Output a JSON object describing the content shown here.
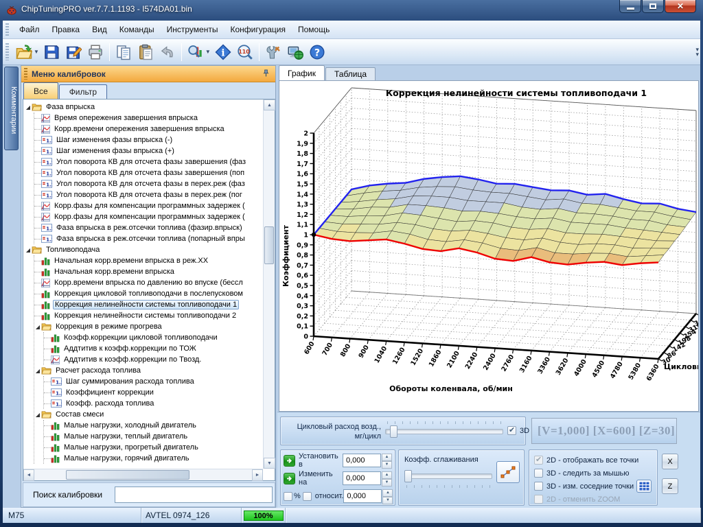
{
  "window": {
    "title": "ChipTuningPRO ver.7.7.1.1193 - I574DA01.bin"
  },
  "menu_bar": {
    "items": [
      "Файл",
      "Правка",
      "Вид",
      "Команды",
      "Инструменты",
      "Конфигурация",
      "Помощь"
    ]
  },
  "toolbar": {
    "buttons": [
      {
        "icon": "open-file-icon",
        "dropdown": true
      },
      {
        "icon": "save-icon"
      },
      {
        "icon": "save-edit-icon"
      },
      {
        "icon": "print-icon",
        "sep_after": true
      },
      {
        "icon": "copy-icon"
      },
      {
        "icon": "paste-icon"
      },
      {
        "icon": "undo-icon",
        "sep_after": true
      },
      {
        "icon": "chart-view-icon",
        "dropdown": true
      },
      {
        "icon": "info-icon"
      },
      {
        "icon": "zoom-110-icon",
        "sep_after": true
      },
      {
        "icon": "tools-icon"
      },
      {
        "icon": "network-icon"
      },
      {
        "icon": "help-icon"
      }
    ]
  },
  "comments_tab": {
    "label": "Комментарии"
  },
  "calibration_panel": {
    "title": "Меню калибровок",
    "tabs": [
      {
        "label": "Все",
        "active": true
      },
      {
        "label": "Фильтр",
        "active": false
      }
    ],
    "search": {
      "label": "Поиск калибровки",
      "value": ""
    },
    "tree": [
      {
        "label": "Фаза впрыска",
        "children": [
          {
            "icon": "curve",
            "label": "Время опережения завершения впрыска"
          },
          {
            "icon": "curve",
            "label": "Корр.времени опережения завершения впрыска"
          },
          {
            "icon": "num",
            "label": "Шаг изменения фазы впрыска (-)"
          },
          {
            "icon": "num",
            "label": "Шаг изменения фазы впрыска (+)"
          },
          {
            "icon": "num",
            "label": "Угол поворота КВ для отсчета фазы завершения (фаз"
          },
          {
            "icon": "num",
            "label": "Угол поворота КВ для отсчета фазы завершения (поп"
          },
          {
            "icon": "num",
            "label": "Угол поворота КВ для отсчета фазы в перех.реж (фаз"
          },
          {
            "icon": "num",
            "label": "Угол поворота КВ для отсчета фазы в перех.реж (пог"
          },
          {
            "icon": "curve",
            "label": "Корр.фазы для компенсации программных задержек ("
          },
          {
            "icon": "curve",
            "label": "Корр.фазы для компенсации программных задержек ("
          },
          {
            "icon": "num",
            "label": "Фаза впрыска в реж.отсечки топлива (фазир.впрыск)"
          },
          {
            "icon": "num",
            "label": "Фаза впрыска в реж.отсечки топлива (попарный впры"
          }
        ]
      },
      {
        "label": "Топливоподача",
        "children": [
          {
            "icon": "bar",
            "label": "Начальная корр.времени впрыска в реж.ХХ"
          },
          {
            "icon": "bar",
            "label": "Начальная корр.времени впрыска"
          },
          {
            "icon": "curve",
            "label": "Корр.времени впрыска по давлению во впуске (бессл"
          },
          {
            "icon": "bar",
            "label": "Коррекция цикловой топливоподачи в послепусковом"
          },
          {
            "icon": "bar",
            "label": "Коррекция нелинейности системы топливоподачи 1",
            "selected": true
          },
          {
            "icon": "bar",
            "label": "Коррекция нелинейности системы топливоподачи 2"
          },
          {
            "label": "Коррекция в режиме прогрева",
            "children": [
              {
                "icon": "bar",
                "label": "Коэфф.коррекции цикловой топливоподачи"
              },
              {
                "icon": "bar",
                "label": "Аддтитив к коэфф.коррекции по ТОЖ"
              },
              {
                "icon": "curve",
                "label": "Аддтитив к коэфф.коррекции по Твозд."
              }
            ]
          },
          {
            "label": "Расчет расхода топлива",
            "children": [
              {
                "icon": "num",
                "label": "Шаг суммирования расхода топлива"
              },
              {
                "icon": "num",
                "label": "Коэффициент коррекции"
              },
              {
                "icon": "num",
                "label": "Коэфф. расхода топлива"
              }
            ]
          },
          {
            "label": "Состав смеси",
            "children": [
              {
                "icon": "bar",
                "label": "Малые нагрузки, холодный двигатель"
              },
              {
                "icon": "bar",
                "label": "Малые нагрузки, теплый двигатель"
              },
              {
                "icon": "bar",
                "label": "Малые нагрузки, прогретый двигатель"
              },
              {
                "icon": "bar",
                "label": "Малые нагрузки, горячий двигатель"
              }
            ]
          }
        ]
      }
    ]
  },
  "view_tabs": [
    {
      "label": "График",
      "active": true
    },
    {
      "label": "Таблица",
      "active": false
    }
  ],
  "controls": {
    "air_label_1": "Цикловый расход возд.,",
    "air_label_2": "мг/цикл",
    "d3_checkbox": "3D",
    "coords": "[V=1,000] [X=600] [Z=30]",
    "set_label": "Установить в",
    "set_value": "0,000",
    "change_label": "Изменить на",
    "change_value": "0,000",
    "percent_label": "%",
    "relative_label": "относит.",
    "percent_value": "0,000",
    "smoothing_label": "Коэфф. сглаживания",
    "options": [
      {
        "label": "2D - отображать все точки",
        "checked": true,
        "disabled": true
      },
      {
        "label": "3D - следить за мышью",
        "checked": false,
        "disabled": false
      },
      {
        "label": "3D - изм. соседние точки",
        "checked": false,
        "disabled": false,
        "grid_button": true
      },
      {
        "label": "2D - отменить ZOOM",
        "checked": false,
        "disabled": true
      }
    ],
    "x_button": "X",
    "z_button": "Z"
  },
  "status_bar": {
    "model": "M75",
    "file": "AVTEL 0974_126",
    "progress": "100%"
  },
  "colors": {
    "header_orange": "#f3a93e",
    "selection_blue": "#cde3f6",
    "progress_green": "#1ec41e",
    "surface_front_edge": "#ff0000",
    "surface_back_edge": "#0000ff"
  },
  "chart_data": {
    "type": "heatmap",
    "style": "3d-surface",
    "title": "Коррекция нелинейности системы топливоподачи 1",
    "xlabel": "Обороты коленвала, об/мин",
    "ylabel": "Коэффициент",
    "zlabel": "Цикловый р",
    "x_ticks": [
      "600",
      "700",
      "800",
      "900",
      "1040",
      "1260",
      "1520",
      "1860",
      "2100",
      "2240",
      "2400",
      "2760",
      "3160",
      "3360",
      "3620",
      "4000",
      "4500",
      "4780",
      "5380",
      "6360"
    ],
    "y_ticks": [
      "0",
      "0,1",
      "0,2",
      "0,3",
      "0,4",
      "0,5",
      "0,6",
      "0,7",
      "0,8",
      "0,9",
      "1",
      "1,1",
      "1,2",
      "1,3",
      "1,4",
      "1,5",
      "1,6",
      "1,7",
      "1,8",
      "1,9",
      "2"
    ],
    "z_ticks": [
      "30",
      "86",
      "142",
      "198",
      "254",
      "310",
      "366",
      "422"
    ],
    "ylim": [
      0,
      2
    ],
    "marker_point": {
      "x": "600",
      "z": "30",
      "value": 1.0
    },
    "front_edge_color": "#ee0000",
    "back_edge_color": "#2222ee",
    "values": [
      [
        1.0,
        0.97,
        0.96,
        0.98,
        1.0,
        0.97,
        0.93,
        0.92,
        0.96,
        0.93,
        0.88,
        0.87,
        0.92,
        0.88,
        0.87,
        0.9,
        0.92,
        0.9,
        0.93,
        0.95
      ],
      [
        1.0,
        0.98,
        0.98,
        0.99,
        1.02,
        1.0,
        0.96,
        0.95,
        0.98,
        0.96,
        0.92,
        0.91,
        0.95,
        0.91,
        0.91,
        0.93,
        0.94,
        0.92,
        0.94,
        0.96
      ],
      [
        1.0,
        0.99,
        1.0,
        1.01,
        1.04,
        1.03,
        1.0,
        0.99,
        1.01,
        0.99,
        0.96,
        0.95,
        0.98,
        0.95,
        0.94,
        0.96,
        0.96,
        0.94,
        0.95,
        0.96
      ],
      [
        1.0,
        1.0,
        1.02,
        1.03,
        1.07,
        1.06,
        1.04,
        1.02,
        1.04,
        1.03,
        1.0,
        0.99,
        1.01,
        0.98,
        0.98,
        0.99,
        0.98,
        0.97,
        0.96,
        0.97
      ],
      [
        1.0,
        1.01,
        1.04,
        1.05,
        1.09,
        1.09,
        1.08,
        1.06,
        1.07,
        1.06,
        1.04,
        1.03,
        1.05,
        1.02,
        1.02,
        1.02,
        1.0,
        0.99,
        0.98,
        0.97
      ],
      [
        1.0,
        1.02,
        1.05,
        1.07,
        1.11,
        1.12,
        1.12,
        1.1,
        1.1,
        1.1,
        1.07,
        1.06,
        1.08,
        1.05,
        1.05,
        1.04,
        1.02,
        1.02,
        0.99,
        0.98
      ],
      [
        1.0,
        1.04,
        1.07,
        1.09,
        1.13,
        1.15,
        1.16,
        1.14,
        1.13,
        1.13,
        1.11,
        1.09,
        1.11,
        1.08,
        1.08,
        1.06,
        1.04,
        1.04,
        1.01,
        0.99
      ],
      [
        1.0,
        1.05,
        1.08,
        1.1,
        1.15,
        1.18,
        1.2,
        1.18,
        1.15,
        1.16,
        1.14,
        1.12,
        1.13,
        1.1,
        1.12,
        1.08,
        1.05,
        1.06,
        1.02,
        1.0
      ]
    ]
  }
}
